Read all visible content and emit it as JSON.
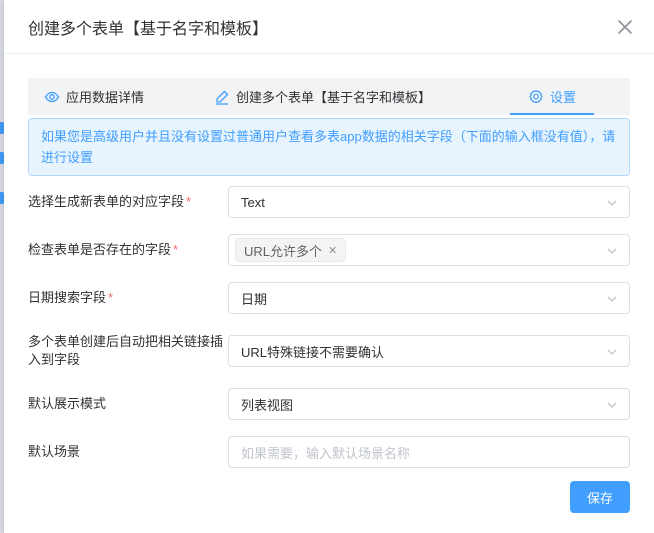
{
  "dialog": {
    "title": "创建多个表单【基于名字和模板】"
  },
  "tabs": [
    {
      "label": "应用数据详情",
      "icon": "eye-icon"
    },
    {
      "label": "创建多个表单【基于名字和模板】",
      "icon": "edit-icon"
    },
    {
      "label": "设置",
      "icon": "gear-icon",
      "active": true
    }
  ],
  "alert": {
    "text": "如果您是高级用户并且没有设置过普通用户查看多表app数据的相关字段（下面的输入框没有值），请进行设置"
  },
  "form": {
    "field1": {
      "label": "选择生成新表单的对应字段",
      "value": "Text",
      "required": true
    },
    "field2": {
      "label": "检查表单是否存在的字段",
      "tag": "URL允许多个",
      "required": true
    },
    "field3": {
      "label": "日期搜索字段",
      "value": "日期",
      "required": true
    },
    "field4": {
      "label": "多个表单创建后自动把相关链接插入到字段",
      "value": "URL特殊链接不需要确认"
    },
    "field5": {
      "label": "默认展示模式",
      "value": "列表视图"
    },
    "field6": {
      "label": "默认场景",
      "placeholder": "如果需要，输入默认场景名称"
    }
  },
  "buttons": {
    "save": "保存"
  },
  "colors": {
    "primary": "#409eff",
    "required": "#f56c6c",
    "alert_bg": "#e8f4fd"
  }
}
